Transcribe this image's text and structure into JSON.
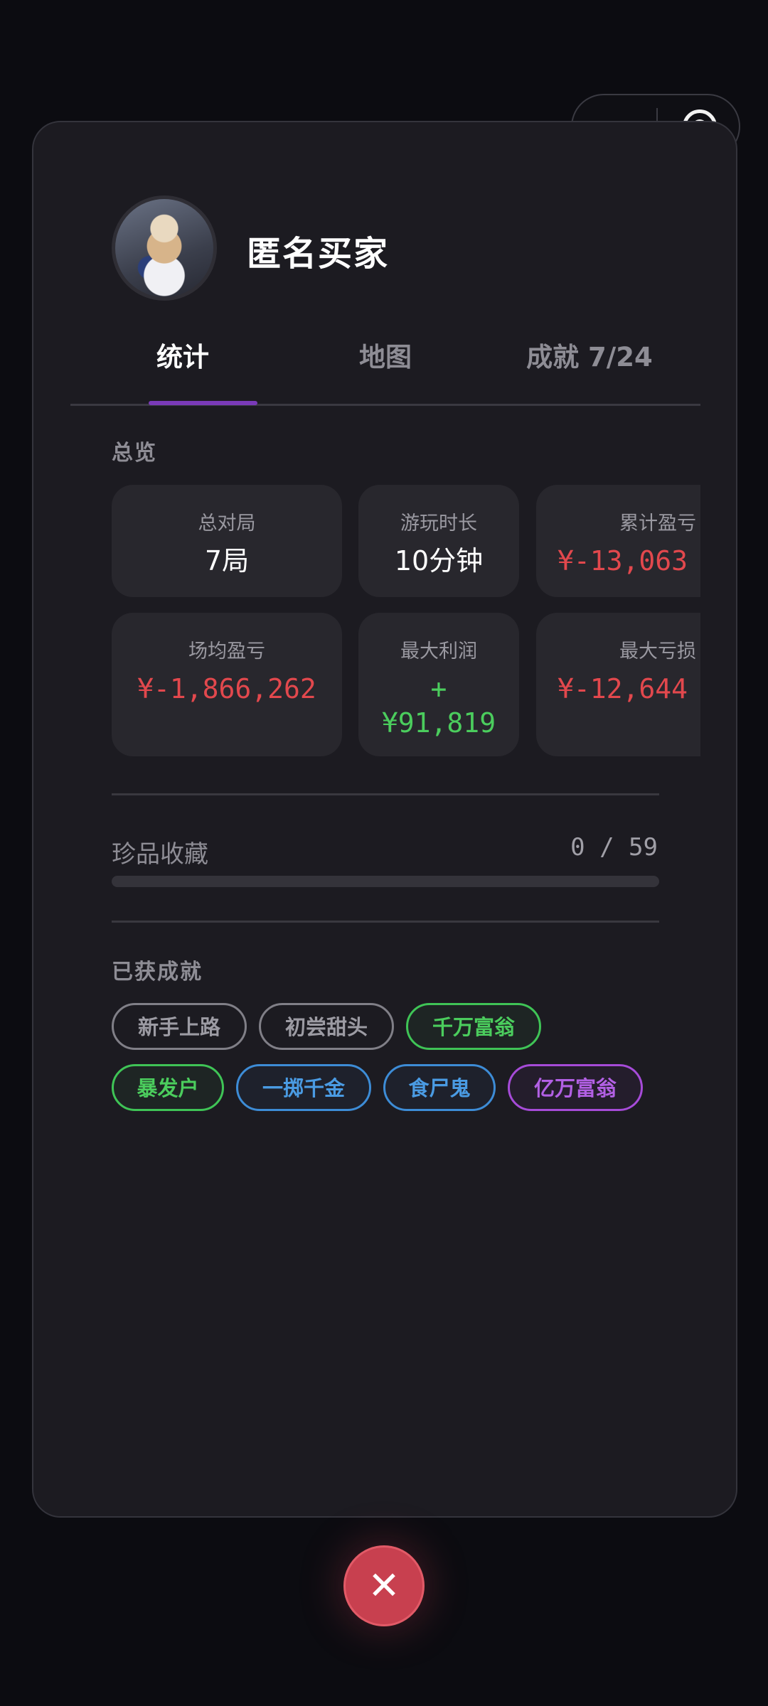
{
  "profile": {
    "username": "匿名买家"
  },
  "tabs": [
    {
      "label": "统计",
      "active": true
    },
    {
      "label": "地图",
      "active": false
    },
    {
      "label": "成就 7/24",
      "active": false
    }
  ],
  "overview": {
    "title": "总览",
    "stats": [
      {
        "label": "总对局",
        "value": "7局",
        "color": "white"
      },
      {
        "label": "游玩时长",
        "value": "10分钟",
        "color": "white"
      },
      {
        "label": "累计盈亏",
        "value": "¥-13,063",
        "color": "red"
      },
      {
        "label": "场均盈亏",
        "value": "¥-1,866,262",
        "color": "red"
      },
      {
        "label": "最大利润",
        "value_line1": "+",
        "value_line2": "¥91,819",
        "color": "green"
      },
      {
        "label": "最大亏损",
        "value": "¥-12,644",
        "color": "red"
      }
    ]
  },
  "collection": {
    "label": "珍品收藏",
    "count": "0  /  59",
    "progress": 0
  },
  "achievements": {
    "title": "已获成就",
    "badges": [
      {
        "label": "新手上路",
        "color": "gray"
      },
      {
        "label": "初尝甜头",
        "color": "gray"
      },
      {
        "label": "千万富翁",
        "color": "green"
      },
      {
        "label": "暴发户",
        "color": "green"
      },
      {
        "label": "一掷千金",
        "color": "blue"
      },
      {
        "label": "食尸鬼",
        "color": "blue"
      },
      {
        "label": "亿万富翁",
        "color": "purple"
      }
    ]
  },
  "close_button": {
    "symbol": "✕"
  }
}
